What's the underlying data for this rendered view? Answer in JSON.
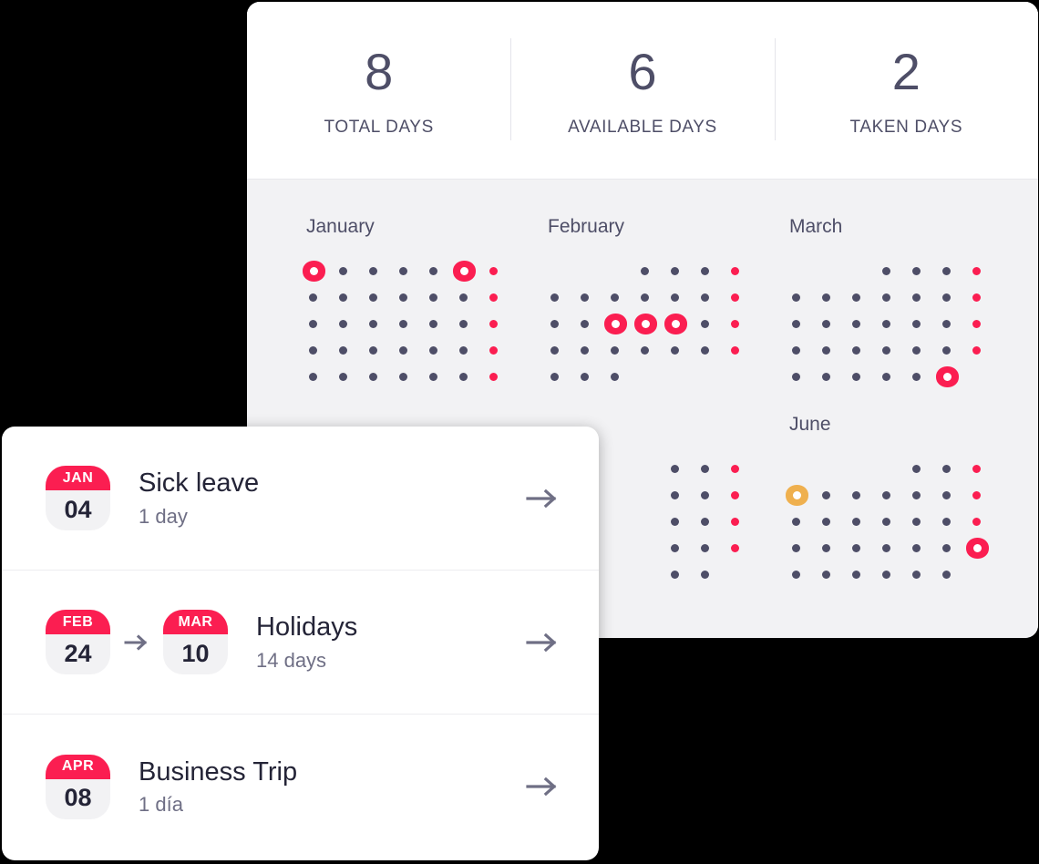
{
  "stats": [
    {
      "value": "8",
      "label": "TOTAL DAYS",
      "name": "total-days"
    },
    {
      "value": "6",
      "label": "AVAILABLE DAYS",
      "name": "available-days"
    },
    {
      "value": "2",
      "label": "TAKEN DAYS",
      "name": "taken-days"
    }
  ],
  "colors": {
    "accent_pink": "#fb1e51",
    "accent_yellow": "#efb04e",
    "dot_dark": "#4e4e67",
    "panel_bg": "#f2f2f4",
    "card_bg": "#ffffff",
    "text_dark": "#242437",
    "text_muted": "#6f6f85"
  },
  "calendar": {
    "legend": {
      "weekday_dot": "dot-dark",
      "weekend_dot": "dot-pink",
      "taken_marker": "marker-pink",
      "pending_marker": "marker-yellow"
    },
    "months": [
      {
        "name": "January",
        "columns": 7,
        "rows": 5,
        "grid": [
          [
            "mk",
            "d",
            "d",
            "d",
            "d",
            "mk",
            "p"
          ],
          [
            "d",
            "d",
            "d",
            "d",
            "d",
            "d",
            "p"
          ],
          [
            "d",
            "d",
            "d",
            "d",
            "d",
            "d",
            "p"
          ],
          [
            "d",
            "d",
            "d",
            "d",
            "d",
            "d",
            "p"
          ],
          [
            "d",
            "d",
            "d",
            "d",
            "d",
            "d",
            "p"
          ]
        ]
      },
      {
        "name": "February",
        "columns": 7,
        "rows": 5,
        "grid": [
          [
            "e",
            "e",
            "e",
            "d",
            "d",
            "d",
            "p"
          ],
          [
            "d",
            "d",
            "d",
            "d",
            "d",
            "d",
            "p"
          ],
          [
            "d",
            "d",
            "mk",
            "mk",
            "mk",
            "d",
            "p"
          ],
          [
            "d",
            "d",
            "d",
            "d",
            "d",
            "d",
            "p"
          ],
          [
            "d",
            "d",
            "d",
            "e",
            "e",
            "e",
            "e"
          ]
        ]
      },
      {
        "name": "March",
        "columns": 7,
        "rows": 5,
        "grid": [
          [
            "e",
            "e",
            "e",
            "d",
            "d",
            "d",
            "p"
          ],
          [
            "d",
            "d",
            "d",
            "d",
            "d",
            "d",
            "p"
          ],
          [
            "d",
            "d",
            "d",
            "d",
            "d",
            "d",
            "p"
          ],
          [
            "d",
            "d",
            "d",
            "d",
            "d",
            "d",
            "p"
          ],
          [
            "d",
            "d",
            "d",
            "d",
            "d",
            "mk",
            "e"
          ]
        ]
      },
      {
        "name": "",
        "columns": 7,
        "rows": 5,
        "occluded": true,
        "grid": [
          [
            "e",
            "e",
            "d",
            "d",
            "d",
            "d",
            "p"
          ],
          [
            "e",
            "e",
            "d",
            "d",
            "d",
            "d",
            "p"
          ],
          [
            "e",
            "e",
            "d",
            "d",
            "d",
            "d",
            "mk"
          ],
          [
            "e",
            "e",
            "d",
            "d",
            "d",
            "d",
            "p"
          ],
          [
            "e",
            "e",
            "d",
            "d",
            "e",
            "e",
            "e"
          ]
        ]
      },
      {
        "name": "",
        "columns": 7,
        "rows": 5,
        "occluded": true,
        "grid": [
          [
            "e",
            "e",
            "e",
            "e",
            "d",
            "d",
            "p"
          ],
          [
            "e",
            "e",
            "e",
            "e",
            "d",
            "d",
            "p"
          ],
          [
            "e",
            "e",
            "e",
            "e",
            "d",
            "d",
            "p"
          ],
          [
            "e",
            "e",
            "e",
            "e",
            "d",
            "d",
            "p"
          ],
          [
            "e",
            "e",
            "e",
            "e",
            "d",
            "d",
            "e"
          ]
        ]
      },
      {
        "name": "June",
        "columns": 7,
        "rows": 5,
        "grid": [
          [
            "e",
            "e",
            "e",
            "e",
            "d",
            "d",
            "p"
          ],
          [
            "mk-yellow",
            "d",
            "d",
            "d",
            "d",
            "d",
            "p"
          ],
          [
            "d",
            "d",
            "d",
            "d",
            "d",
            "d",
            "p"
          ],
          [
            "d",
            "d",
            "d",
            "d",
            "d",
            "d",
            "mk"
          ],
          [
            "d",
            "d",
            "d",
            "d",
            "d",
            "d",
            "e"
          ]
        ]
      }
    ]
  },
  "leave_list": {
    "items": [
      {
        "start": {
          "month": "JAN",
          "day": "04"
        },
        "end": null,
        "title": "Sick leave",
        "duration": "1 day"
      },
      {
        "start": {
          "month": "FEB",
          "day": "24"
        },
        "end": {
          "month": "MAR",
          "day": "10"
        },
        "title": "Holidays",
        "duration": "14 days"
      },
      {
        "start": {
          "month": "APR",
          "day": "08"
        },
        "end": null,
        "title": "Business Trip",
        "duration": "1 día"
      }
    ]
  }
}
